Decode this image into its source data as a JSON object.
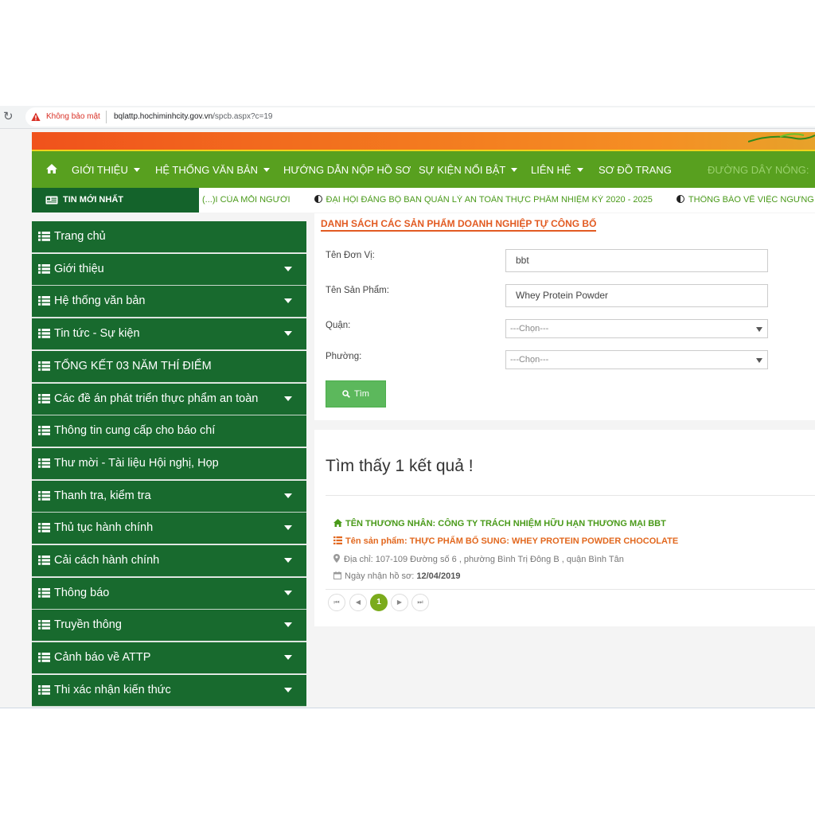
{
  "browser": {
    "security_label": "Không bảo mật",
    "url_host": "bqlattp.hochiminhcity.gov.vn",
    "url_path": "/spcb.aspx?c=19"
  },
  "topnav": {
    "items": [
      "GIỚI THIỆU",
      "HỆ THỐNG VĂN BẢN",
      "HƯỚNG DẪN NỘP HỒ SƠ",
      "SỰ KIỆN NỔI BẬT",
      "LIÊN HỆ",
      "SƠ ĐỒ TRANG"
    ],
    "hotline": "ĐƯỜNG DÂY NÓNG:"
  },
  "ticker": {
    "label": "TIN MỚI NHẤT",
    "items": [
      "(...)I CỦA MỖI NGƯỜI",
      "ĐẠI HỘI ĐẢNG BỘ BAN QUẢN LÝ AN TOÀN THỰC PHẨM NHIỆM KỲ 2020 - 2025",
      "THÔNG BÁO VỀ VIỆC NGƯNG"
    ]
  },
  "sidebar": {
    "items": [
      {
        "label": "Trang chủ"
      },
      {
        "label": "Giới thiệu"
      },
      {
        "label": "Hệ thống văn bản"
      },
      {
        "label": "Tin tức - Sự kiện"
      },
      {
        "label": "TỔNG KẾT 03 NĂM THÍ ĐIỂM"
      },
      {
        "label": "Các đề án phát triển thực phẩm an toàn"
      },
      {
        "label": "Thông tin cung cấp cho báo chí"
      },
      {
        "label": "Thư mời - Tài liệu Hội nghị, Họp"
      },
      {
        "label": "Thanh tra, kiểm tra"
      },
      {
        "label": "Thủ tục hành chính"
      },
      {
        "label": "Cải cách hành chính"
      },
      {
        "label": "Thông báo"
      },
      {
        "label": "Truyền thông"
      },
      {
        "label": "Cảnh báo về ATTP"
      },
      {
        "label": "Thi xác nhận kiến thức"
      }
    ]
  },
  "search": {
    "heading": "DANH SÁCH CÁC SẢN PHẨM DOANH NGHIỆP TỰ CÔNG BỐ",
    "unit_label": "Tên Đơn Vị:",
    "unit_value": "bbt",
    "product_label": "Tên Sản Phẩm:",
    "product_value": "Whey Protein Powder",
    "district_label": "Quận:",
    "district_value": "---Chọn---",
    "ward_label": "Phường:",
    "ward_value": "---Chọn---",
    "button_label": "Tìm"
  },
  "results": {
    "title": "Tìm thấy 1 kết quả !",
    "merchant": "TÊN THƯƠNG NHÂN: CÔNG TY TRÁCH NHIỆM HỮU HẠN THƯƠNG MẠI BBT",
    "product": "Tên sản phẩm: THỰC PHẨM BỔ SUNG: WHEY PROTEIN POWDER CHOCOLATE",
    "address": "Địa chỉ: 107-109 Đường số 6 , phường Bình Trị Đông B , quận Bình Tân",
    "received_label": "Ngày nhận hồ sơ:",
    "received_date": "12/04/2019",
    "current_page": "1"
  },
  "colors": {
    "nav_green": "#58a01f",
    "sidebar_green": "#186a2e",
    "accent_orange": "#e25b22",
    "button_green": "#5cb85c",
    "merchant_green": "#4a9a1a",
    "pager_active": "#7bab1c"
  }
}
